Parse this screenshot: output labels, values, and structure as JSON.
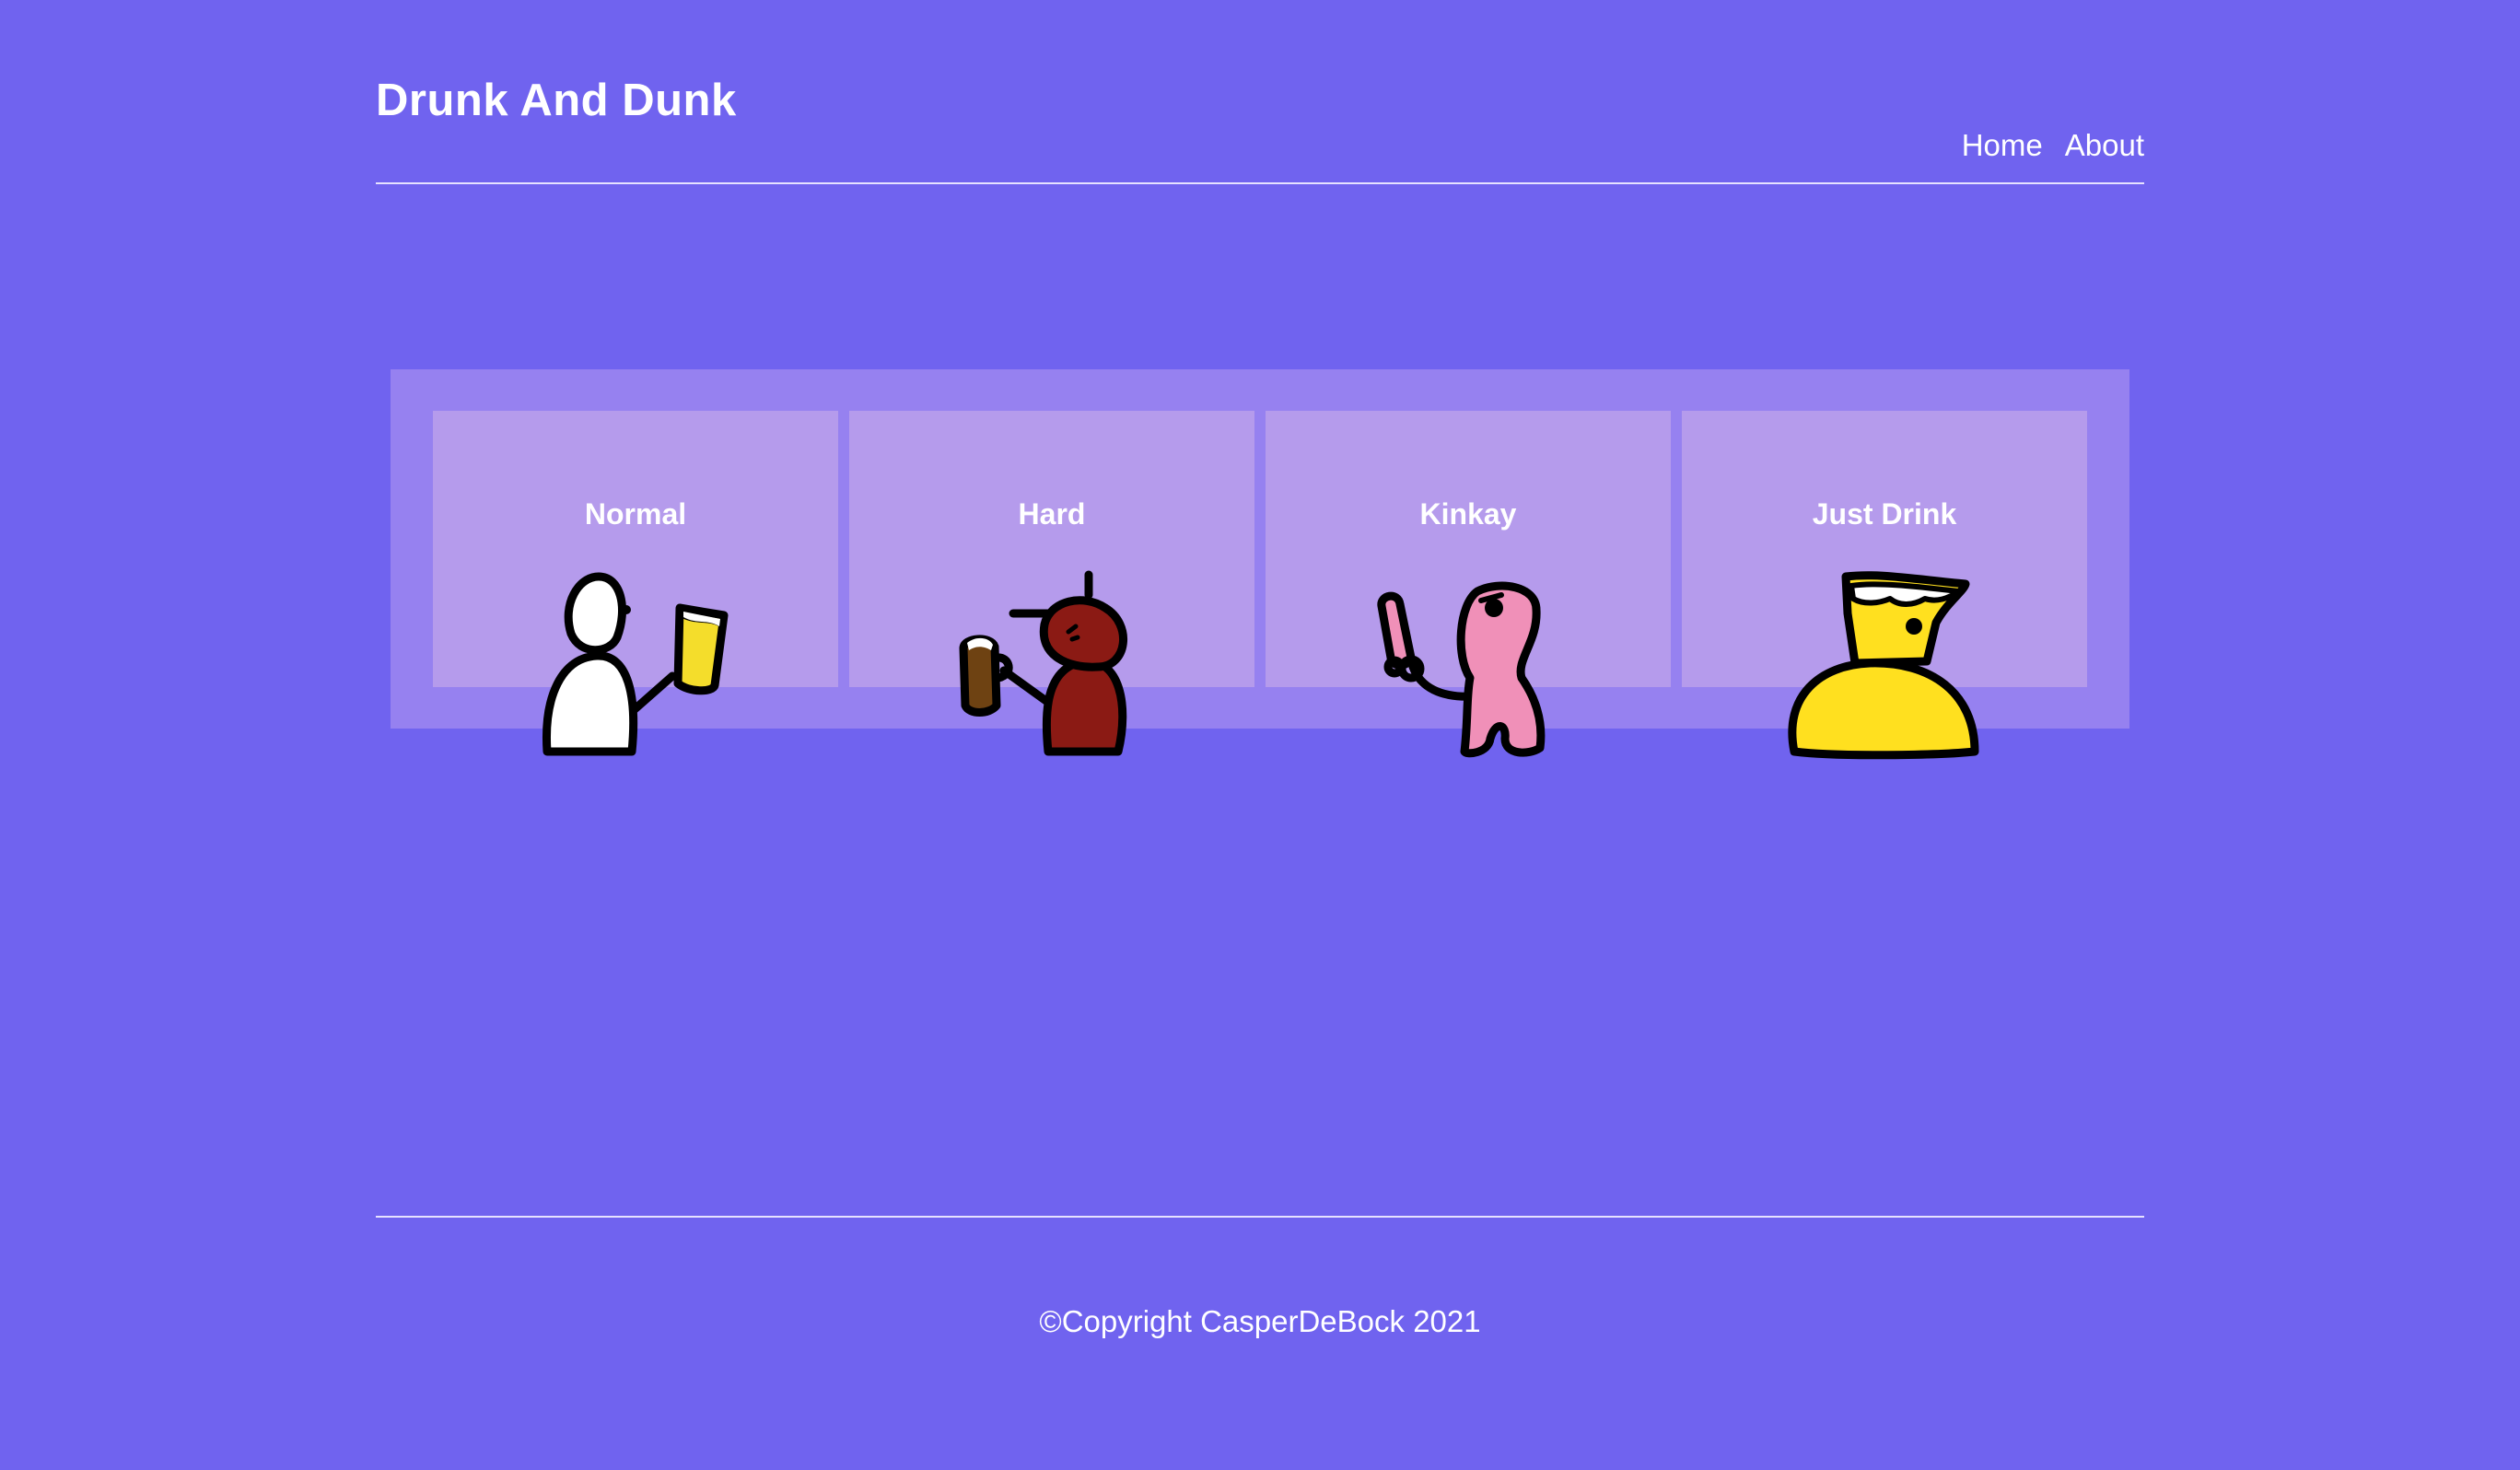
{
  "header": {
    "site_title": "Drunk And Dunk",
    "nav": [
      {
        "label": "Home"
      },
      {
        "label": "About"
      }
    ]
  },
  "cards": [
    {
      "title": "Normal",
      "icon": "white-blob-holding-beer-icon",
      "body_color": "#FFFFFF",
      "drink_color": "#F4DD2B"
    },
    {
      "title": "Hard",
      "icon": "red-blob-holding-dark-beer-icon",
      "body_color": "#8B1A14",
      "drink_color": "#6E4212"
    },
    {
      "title": "Kinkay",
      "icon": "pink-worm-holding-drink-icon",
      "body_color": "#F090B8",
      "drink_color": "#F090B8"
    },
    {
      "title": "Just Drink",
      "icon": "yellow-beer-drinker-icon",
      "body_color": "#FFE01F",
      "drink_color": "#FFE01F"
    }
  ],
  "footer": {
    "copyright": "©Copyright CasperDeBock 2021"
  },
  "colors": {
    "background": "#7063EF",
    "panel": "#9681F0",
    "card": "#B59BEC",
    "text": "#FFFFFF"
  }
}
